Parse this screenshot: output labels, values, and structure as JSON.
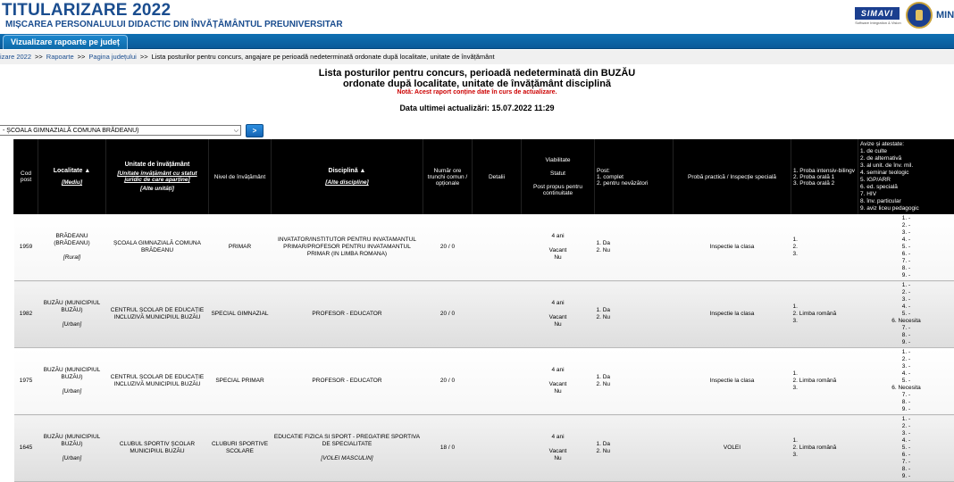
{
  "header": {
    "title": "TITULARIZARE 2022",
    "subtitle": "MIȘCAREA PERSONALULUI DIDACTIC DIN ÎNVĂȚĂMÂNTUL PREUNIVERSITAR",
    "logo_text": "SIMAVI",
    "logo_tagline": "Software Integration & Vision",
    "ministry_text": "MIN"
  },
  "tabs": [
    {
      "label": "Vizualizare rapoarte pe județ"
    }
  ],
  "breadcrumb": [
    "izare 2022",
    "Rapoarte",
    "Pagina județului",
    "Lista posturilor pentru concurs, angajare pe perioadă nedeterminată ordonate după localitate, unitate de învățământ"
  ],
  "report": {
    "title_line1": "Lista posturilor pentru concurs, perioadă nedeterminată din BUZĂU",
    "title_line2": "ordonate după localitate, unitate de învățământ disciplină",
    "note": "Notă: Acest raport conține date în curs de actualizare.",
    "updated": "Data ultimei actualizări: 15.07.2022 11:29"
  },
  "filter": {
    "selected": "- ȘCOALA GIMNAZIALĂ COMUNA BRĂDEANU)",
    "go_label": ">"
  },
  "table": {
    "headers": {
      "cod": "Cod post",
      "localitate": "Localitate ▲",
      "localitate_sub": "[Mediu]",
      "unitate": "Unitate de învățământ",
      "unitate_sub": "[Unitate învățământ cu statut juridic de care aparține]",
      "unitate_sub2": "[Alte unități]",
      "nivel": "Nivel de învățământ",
      "disciplina": "Disciplină ▲",
      "disciplina_sub": "[Alte discipline]",
      "ore": "Număr ore trunchi comun / opționale",
      "detalii": "Detalii",
      "viab1": "Viabilitate",
      "viab2": "Statut",
      "viab3": "Post propus pentru continuitate",
      "post": "Post:",
      "post1": "1. complet",
      "post2": "2. pentru nevăzători",
      "proba": "Probă practică / Inspecție specială",
      "probe1": "1. Proba intensiv-bilingv",
      "probe2": "2. Proba orală 1",
      "probe3": "3. Proba orală 2",
      "avize": [
        "Avize și atestate:",
        "1. de culte",
        "2. de alternativă",
        "3. al unit. de înv. mil.",
        "4. seminar teologic",
        "5. IGP/ARR",
        "6. ed. specială",
        "7. HIV",
        "8. înv. particular",
        "9. aviz liceu pedagogic"
      ]
    },
    "rows": [
      {
        "cod": "1959",
        "localitate": "BRĂDEANU (BRĂDEANU)",
        "mediu": "[Rural]",
        "unitate": "ȘCOALA GIMNAZIALĂ COMUNA BRĂDEANU",
        "nivel": "PRIMAR",
        "disciplina": "INVATATOR/INSTITUTOR PENTRU INVATAMANTUL PRIMAR/PROFESOR PENTRU INVATAMANTUL PRIMAR (IN LIMBA ROMANA)",
        "disciplina_sub": "",
        "ore": "20 / 0",
        "viab": "4 ani",
        "statut": "Vacant",
        "continuitate": "Nu",
        "post1": "1.  Da",
        "post2": "2.  Nu",
        "proba": "Inspectie la clasa",
        "probe1": "1.",
        "probe2": "2.",
        "probe3": "3.",
        "avize": [
          "1.  -",
          "2.  -",
          "3.  -",
          "4.  -",
          "5.  -",
          "6.  -",
          "7.  -",
          "8.  -",
          "9.  -"
        ]
      },
      {
        "cod": "1982",
        "localitate": "BUZĂU (MUNICIPIUL BUZĂU)",
        "mediu": "[Urban]",
        "unitate": "CENTRUL ȘCOLAR DE EDUCAȚIE INCLUZIVĂ MUNICIPIUL BUZĂU",
        "nivel": "SPECIAL GIMNAZIAL",
        "disciplina": "PROFESOR - EDUCATOR",
        "disciplina_sub": "",
        "ore": "20 / 0",
        "viab": "4 ani",
        "statut": "Vacant",
        "continuitate": "Nu",
        "post1": "1.  Da",
        "post2": "2.  Nu",
        "proba": "Inspectie la clasa",
        "probe1": "1.",
        "probe2": "2.  Limba română",
        "probe3": "3.",
        "avize": [
          "1.  -",
          "2.  -",
          "3.  -",
          "4.  -",
          "5.  -",
          "6.  Necesita",
          "7.  -",
          "8.  -",
          "9.  -"
        ]
      },
      {
        "cod": "1975",
        "localitate": "BUZĂU (MUNICIPIUL BUZĂU)",
        "mediu": "[Urban]",
        "unitate": "CENTRUL ȘCOLAR DE EDUCAȚIE INCLUZIVĂ MUNICIPIUL BUZĂU",
        "nivel": "SPECIAL PRIMAR",
        "disciplina": "PROFESOR - EDUCATOR",
        "disciplina_sub": "",
        "ore": "20 / 0",
        "viab": "4 ani",
        "statut": "Vacant",
        "continuitate": "Nu",
        "post1": "1.  Da",
        "post2": "2.  Nu",
        "proba": "Inspectie la clasa",
        "probe1": "1.",
        "probe2": "2.  Limba română",
        "probe3": "3.",
        "avize": [
          "1.  -",
          "2.  -",
          "3.  -",
          "4.  -",
          "5.  -",
          "6.  Necesita",
          "7.  -",
          "8.  -",
          "9.  -"
        ]
      },
      {
        "cod": "1645",
        "localitate": "BUZĂU (MUNICIPIUL BUZĂU)",
        "mediu": "[Urban]",
        "unitate": "CLUBUL SPORTIV ȘCOLAR MUNICIPIUL BUZĂU",
        "nivel": "CLUBURI SPORTIVE SCOLARE",
        "disciplina": "EDUCATIE FIZICA SI SPORT - PREGATIRE SPORTIVA DE SPECIALITATE",
        "disciplina_sub": "[VOLEI MASCULIN]",
        "ore": "18 / 0",
        "viab": "4 ani",
        "statut": "Vacant",
        "continuitate": "Nu",
        "post1": "1.  Da",
        "post2": "2.  Nu",
        "proba": "VOLEI",
        "probe1": "1.",
        "probe2": "2.  Limba română",
        "probe3": "3.",
        "avize": [
          "1.  -",
          "2.  -",
          "3.  -",
          "4.  -",
          "5.  -",
          "6.  -",
          "7.  -",
          "8.  -",
          "9.  -"
        ]
      }
    ]
  }
}
